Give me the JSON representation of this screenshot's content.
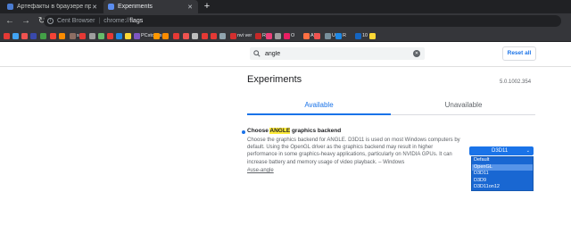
{
  "tabs": [
    {
      "title": "Артефакты в браузере при про",
      "active": false,
      "favicon_color": "#4a7bd0"
    },
    {
      "title": "Experiments",
      "active": true,
      "favicon_color": "#5b8def"
    }
  ],
  "toolbar": {
    "site_label": "Cent Browser",
    "url_scheme": "chrome://",
    "url_path": "flags"
  },
  "bookmarks": [
    {
      "label": "",
      "color": "#e53935"
    },
    {
      "label": "",
      "color": "#42a5f5"
    },
    {
      "label": "",
      "color": "#ef5350"
    },
    {
      "label": "",
      "color": "#3949ab"
    },
    {
      "label": "",
      "color": "#43a047"
    },
    {
      "label": "",
      "color": "#f44336"
    },
    {
      "label": "",
      "color": "#fb8c00"
    },
    {
      "label": "s",
      "color": "#8d6e63"
    },
    {
      "label": "",
      "color": "#e53935"
    },
    {
      "label": "",
      "color": "#9e9e9e"
    },
    {
      "label": "",
      "color": "#66bb6a"
    },
    {
      "label": "",
      "color": "#e53935"
    },
    {
      "label": "",
      "color": "#1e88e5"
    },
    {
      "label": "",
      "color": "#fdd835"
    },
    {
      "label": "PCstonks",
      "color": "#7e57c2"
    },
    {
      "label": "",
      "color": "#ff9800"
    },
    {
      "label": "",
      "color": "#fb8c00"
    },
    {
      "label": "",
      "color": "#e53935"
    },
    {
      "label": "",
      "color": "#ef5350"
    },
    {
      "label": "",
      "color": "#bdbdbd"
    },
    {
      "label": "",
      "color": "#e53935"
    },
    {
      "label": "",
      "color": "#e53935"
    },
    {
      "label": "",
      "color": "#90a4ae"
    },
    {
      "label": "nvi ver",
      "color": "#d32f2f"
    },
    {
      "label": "R",
      "color": "#c62828"
    },
    {
      "label": "",
      "color": "#ec407a"
    },
    {
      "label": "",
      "color": "#9e9e9e"
    },
    {
      "label": "O",
      "color": "#e91e63"
    },
    {
      "label": "Ali",
      "color": "#ff7043"
    },
    {
      "label": "",
      "color": "#ef5350"
    },
    {
      "label": "U",
      "color": "#78909c"
    },
    {
      "label": "R",
      "color": "#1e88e5"
    },
    {
      "label": "10",
      "color": "#1565c0"
    },
    {
      "label": "",
      "color": "#fdd835"
    }
  ],
  "search": {
    "value": "angle",
    "placeholder": "Search flags"
  },
  "reset_label": "Reset all",
  "heading": "Experiments",
  "version": "5.0.1002.354",
  "page_tabs": {
    "available": "Available",
    "unavailable": "Unavailable"
  },
  "experiment": {
    "name_before": "Choose ",
    "name_highlight": "ANGLE",
    "name_after": " graphics backend",
    "description": "Choose the graphics backend for ANGLE. D3D11 is used on most Windows computers by default. Using the OpenGL driver as the graphics backend may result in higher performance in some graphics-heavy applications, particularly on NVIDIA GPUs. It can increase battery and memory usage of video playback. – Windows",
    "link": "#use-angle",
    "selected_value": "D3D11",
    "options": [
      "Default",
      "OpenGL",
      "D3D11",
      "D3D9",
      "D3D11on12"
    ],
    "highlighted_option": "OpenGL"
  },
  "colors": {
    "accent": "#1a73e8",
    "highlight": "#ffeb3b",
    "chrome_dark": "#35363a"
  }
}
